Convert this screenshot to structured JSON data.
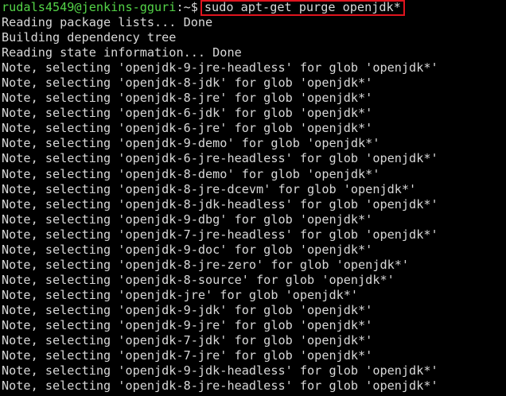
{
  "terminal": {
    "prompt": {
      "user_host": "rudals4549@jenkins-gguri",
      "separator": ":",
      "path": "~$",
      "command": "sudo apt-get purge openjdk*"
    },
    "lines": [
      "Reading package lists... Done",
      "Building dependency tree",
      "Reading state information... Done",
      "Note, selecting 'openjdk-9-jre-headless' for glob 'openjdk*'",
      "Note, selecting 'openjdk-8-jdk' for glob 'openjdk*'",
      "Note, selecting 'openjdk-8-jre' for glob 'openjdk*'",
      "Note, selecting 'openjdk-6-jdk' for glob 'openjdk*'",
      "Note, selecting 'openjdk-6-jre' for glob 'openjdk*'",
      "Note, selecting 'openjdk-9-demo' for glob 'openjdk*'",
      "Note, selecting 'openjdk-6-jre-headless' for glob 'openjdk*'",
      "Note, selecting 'openjdk-8-demo' for glob 'openjdk*'",
      "Note, selecting 'openjdk-8-jre-dcevm' for glob 'openjdk*'",
      "Note, selecting 'openjdk-8-jdk-headless' for glob 'openjdk*'",
      "Note, selecting 'openjdk-9-dbg' for glob 'openjdk*'",
      "Note, selecting 'openjdk-7-jre-headless' for glob 'openjdk*'",
      "Note, selecting 'openjdk-9-doc' for glob 'openjdk*'",
      "Note, selecting 'openjdk-8-jre-zero' for glob 'openjdk*'",
      "Note, selecting 'openjdk-8-source' for glob 'openjdk*'",
      "Note, selecting 'openjdk-jre' for glob 'openjdk*'",
      "Note, selecting 'openjdk-9-jdk' for glob 'openjdk*'",
      "Note, selecting 'openjdk-9-jre' for glob 'openjdk*'",
      "Note, selecting 'openjdk-7-jdk' for glob 'openjdk*'",
      "Note, selecting 'openjdk-7-jre' for glob 'openjdk*'",
      "Note, selecting 'openjdk-9-jdk-headless' for glob 'openjdk*'",
      "Note, selecting 'openjdk-8-jre-headless' for glob 'openjdk*'"
    ],
    "colors": {
      "background": "#000000",
      "text": "#d8d8d8",
      "prompt_user": "#54d448",
      "highlight_box": "#e0141e"
    }
  }
}
